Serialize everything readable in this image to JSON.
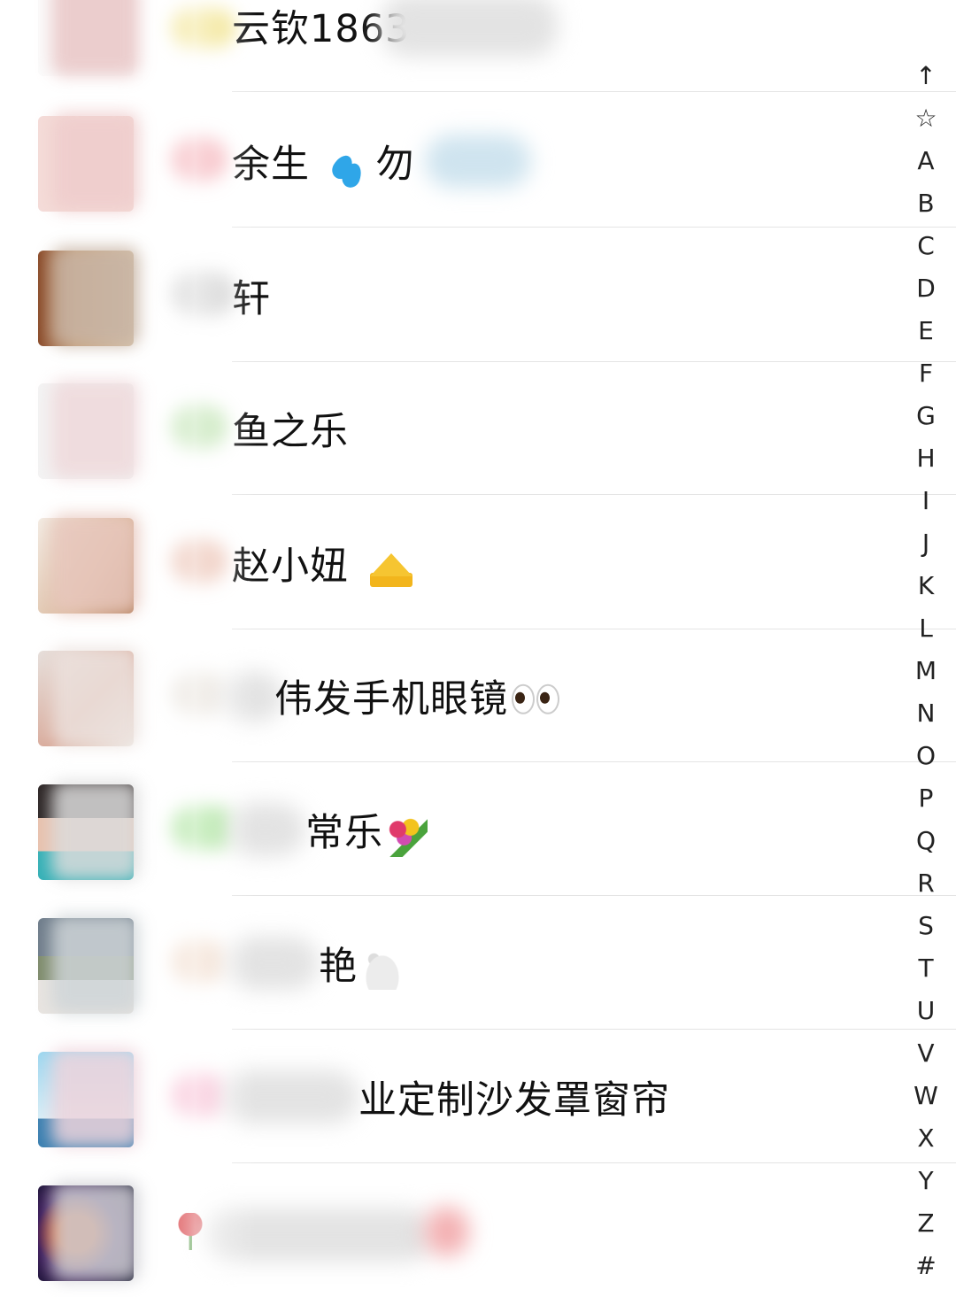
{
  "contacts": [
    {
      "name": "云钦1863",
      "emoji": ""
    },
    {
      "name": "余生 ",
      "emoji": "sweat-drops",
      "tail": "勿"
    },
    {
      "name": "轩",
      "emoji": ""
    },
    {
      "name": "鱼之乐",
      "emoji": ""
    },
    {
      "name": "赵小妞",
      "emoji": "crown"
    },
    {
      "name": "伟发手机眼镜",
      "emoji": "eyes"
    },
    {
      "name": "常乐",
      "emoji": "bouquet"
    },
    {
      "name": "艳",
      "emoji": "rabbit"
    },
    {
      "name": "业定制沙发罩窗帘",
      "emoji": ""
    },
    {
      "name": "",
      "emoji": "rose"
    }
  ],
  "index": [
    "↑",
    "☆",
    "A",
    "B",
    "C",
    "D",
    "E",
    "F",
    "G",
    "H",
    "I",
    "J",
    "K",
    "L",
    "M",
    "N",
    "O",
    "P",
    "Q",
    "R",
    "S",
    "T",
    "U",
    "V",
    "W",
    "X",
    "Y",
    "Z",
    "#"
  ],
  "colors": {
    "separator": "#e4e4e4",
    "background": "#ffffff"
  }
}
